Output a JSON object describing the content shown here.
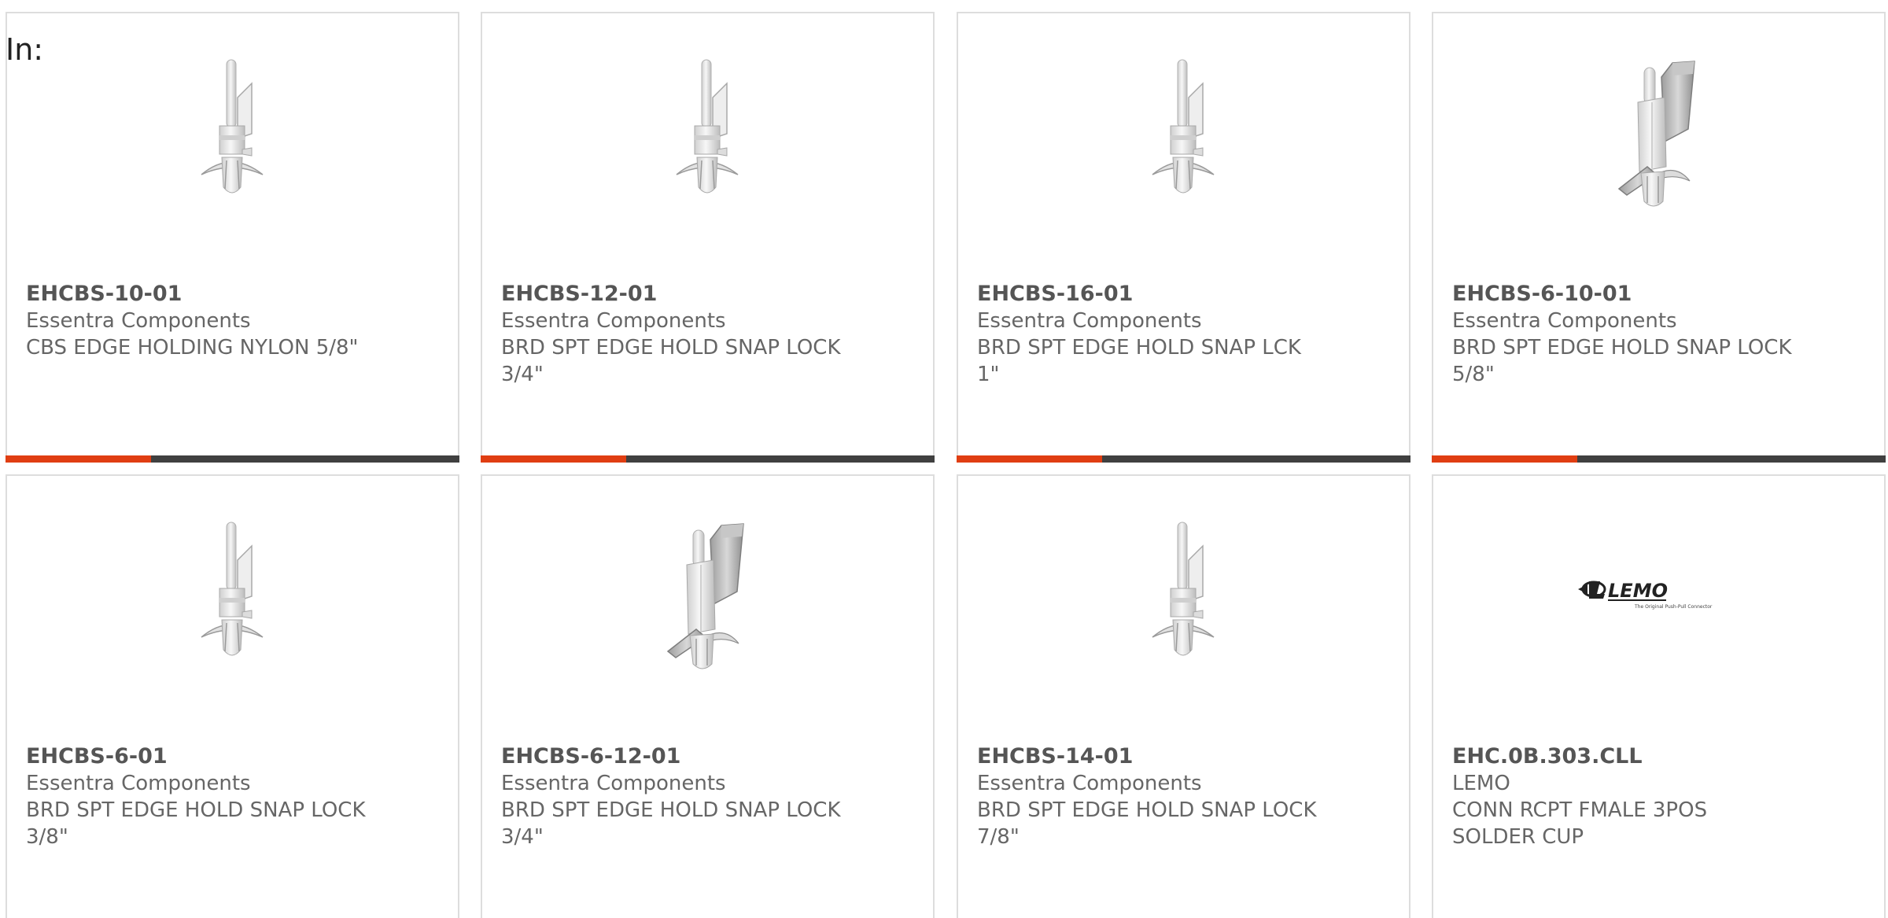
{
  "header": {
    "in_label": "In:"
  },
  "colors": {
    "accent": "#e03e12",
    "track": "#404040",
    "border": "#dddddd",
    "text": "#666666"
  },
  "products": [
    {
      "part_number": "EHCBS-10-01",
      "manufacturer": "Essentra Components",
      "desc_line1": "CBS EDGE HOLDING NYLON 5/8\"",
      "desc_line2": "",
      "image": "edge-holder-icon",
      "progress": 0.32
    },
    {
      "part_number": "EHCBS-12-01",
      "manufacturer": "Essentra Components",
      "desc_line1": "BRD SPT EDGE HOLD SNAP LOCK",
      "desc_line2": "3/4\"",
      "image": "edge-holder-icon",
      "progress": 0.32
    },
    {
      "part_number": "EHCBS-16-01",
      "manufacturer": "Essentra Components",
      "desc_line1": "BRD SPT EDGE HOLD SNAP LCK",
      "desc_line2": "1\"",
      "image": "edge-holder-icon",
      "progress": 0.32
    },
    {
      "part_number": "EHCBS-6-10-01",
      "manufacturer": "Essentra Components",
      "desc_line1": "BRD SPT EDGE HOLD SNAP LOCK",
      "desc_line2": "5/8\"",
      "image": "edge-holder-wide-icon",
      "progress": 0.32
    },
    {
      "part_number": "EHCBS-6-01",
      "manufacturer": "Essentra Components",
      "desc_line1": "BRD SPT EDGE HOLD SNAP LOCK",
      "desc_line2": "3/8\"",
      "image": "edge-holder-icon"
    },
    {
      "part_number": "EHCBS-6-12-01",
      "manufacturer": "Essentra Components",
      "desc_line1": "BRD SPT EDGE HOLD SNAP LOCK",
      "desc_line2": "3/4\"",
      "image": "edge-holder-wide-icon"
    },
    {
      "part_number": "EHCBS-14-01",
      "manufacturer": "Essentra Components",
      "desc_line1": "BRD SPT EDGE HOLD SNAP LOCK",
      "desc_line2": "7/8\"",
      "image": "edge-holder-icon"
    },
    {
      "part_number": "EHC.0B.303.CLL",
      "manufacturer": "LEMO",
      "desc_line1": "CONN RCPT FMALE 3POS",
      "desc_line2": "SOLDER CUP",
      "image": "lemo-logo",
      "logo_text": "LEMO",
      "logo_tagline": "The Original Push-Pull Connector"
    }
  ]
}
